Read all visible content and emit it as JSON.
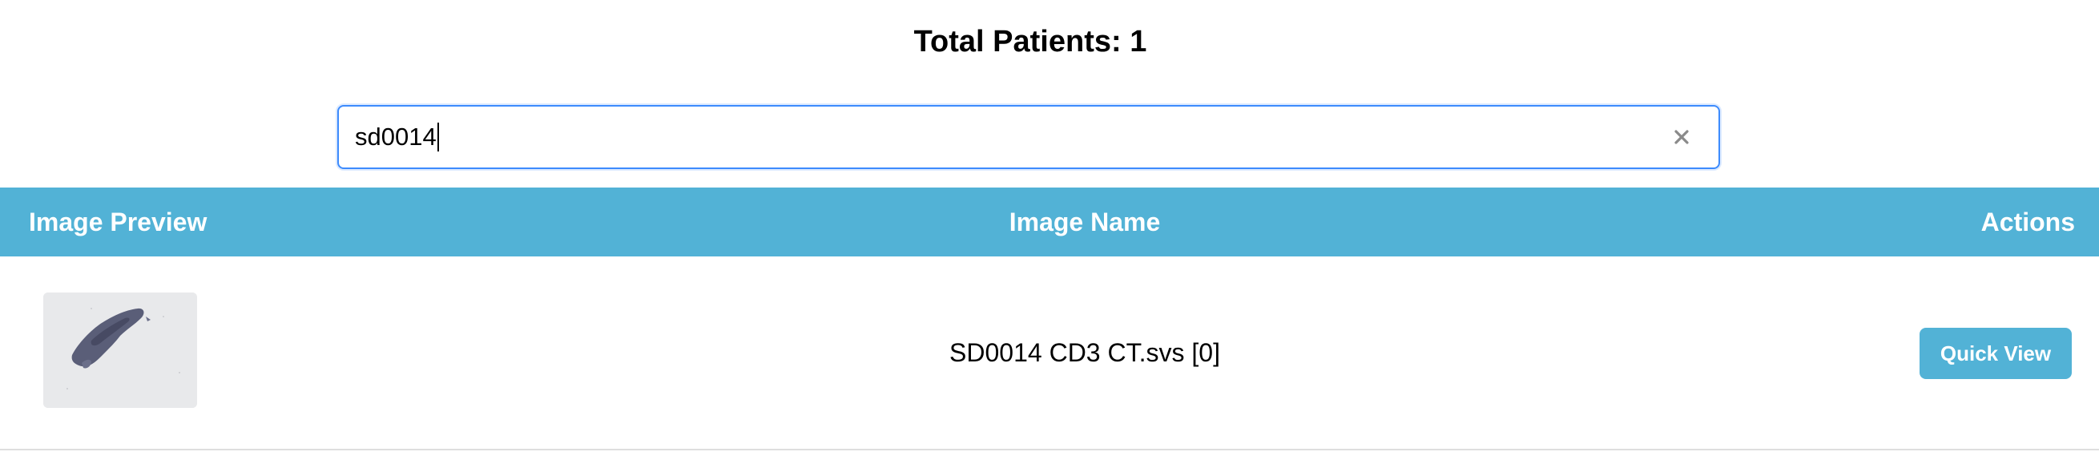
{
  "header": {
    "total_patients": "Total Patients: 1"
  },
  "search": {
    "value": "sd0014",
    "clear_icon": "close-icon"
  },
  "table": {
    "columns": [
      "Image Preview",
      "Image Name",
      "Actions"
    ],
    "rows": [
      {
        "image_name": "SD0014 CD3 CT.svs [0]",
        "action_label": "Quick View"
      }
    ]
  },
  "colors": {
    "accent": "#52b2d6",
    "focus_border": "#3d8bfd",
    "thumbnail_bg": "#e7e8ea",
    "tissue": "#5a5e78"
  }
}
